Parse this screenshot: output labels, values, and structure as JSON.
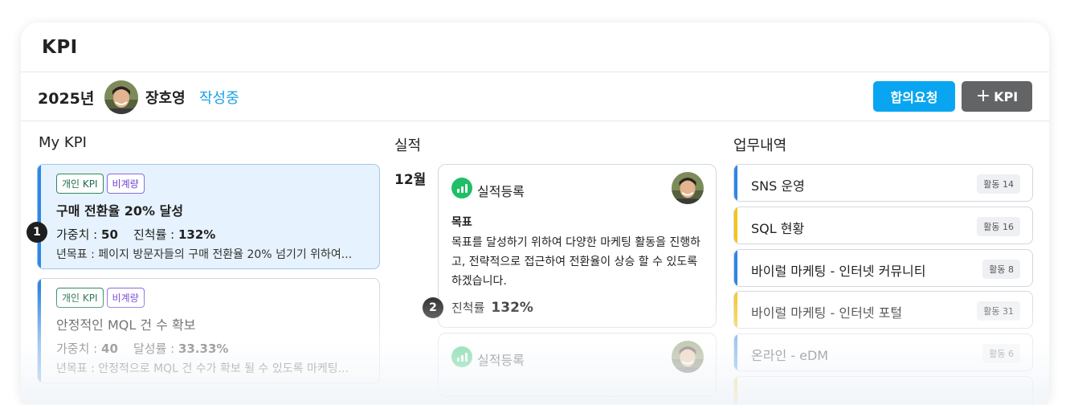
{
  "header": {
    "title": "KPI"
  },
  "info_bar": {
    "year": "2025년",
    "user_name": "장호영",
    "status": "작성중",
    "agree_button": "합의요청",
    "add_button": "KPI",
    "add_button_icon": "plus-icon"
  },
  "my_kpi": {
    "title": "My KPI",
    "cards": [
      {
        "tags": [
          "개인 KPI",
          "비계량"
        ],
        "title": "구매 전환율 20% 달성",
        "weight_label": "가중치 :",
        "weight_value": "50",
        "progress_label": "진척률 :",
        "progress_value": "132%",
        "goal": "년목표 : 페이지 방문자들의 구매 전환율 20% 넘기기 위하여..."
      },
      {
        "tags": [
          "개인 KPI",
          "비계량"
        ],
        "title": "안정적인 MQL 건 수 확보",
        "weight_label": "가중치 :",
        "weight_value": "40",
        "progress_label": "달성률 :",
        "progress_value": "33.33%",
        "goal": "년목표 : 안정적으로 MQL 건 수가 확보 될 수 있도록 마케팅..."
      }
    ]
  },
  "performance": {
    "title": "실적",
    "month": "12월",
    "cards": [
      {
        "heading": "실적등록",
        "goal_label": "목표",
        "goal_text": "목표를 달성하기 위하여 다양한 마케팅 활동을 진행하고, 전략적으로 접근하여 전환율이 상승 할 수 있도록 하겠습니다.",
        "progress_label": "진척률",
        "progress_value": "132%"
      },
      {
        "heading": "실적등록"
      }
    ]
  },
  "work_history": {
    "title": "업무내역",
    "items": [
      {
        "label": "SNS 운영",
        "badge": "활동 14",
        "accent": "#2f87e4"
      },
      {
        "label": "SQL 현황",
        "badge": "활동 16",
        "accent": "#f5c518"
      },
      {
        "label": "바이럴 마케팅 - 인터넷 커뮤니티",
        "badge": "활동 8",
        "accent": "#2f87e4"
      },
      {
        "label": "바이럴 마케팅 - 인터넷 포털",
        "badge": "활동 31",
        "accent": "#f5c518"
      },
      {
        "label": "온라인 - eDM",
        "badge": "활동 6",
        "accent": "#2f87e4"
      }
    ]
  },
  "markers": [
    "1",
    "2"
  ],
  "colors": {
    "primary": "#0aa5f0",
    "status": "#1aa1e6",
    "add_button": "#636466",
    "kpi_accent": "#2f87e4",
    "chart_icon": "#1fbf66"
  }
}
